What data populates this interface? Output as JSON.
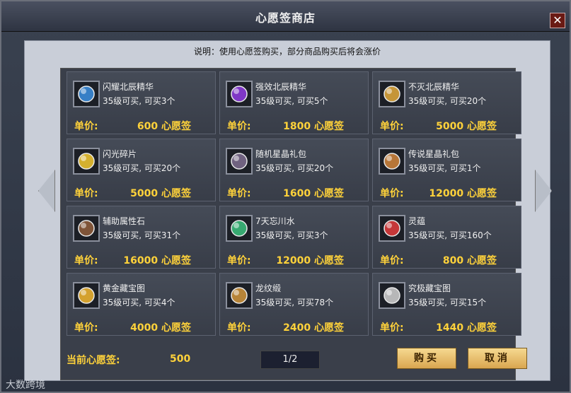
{
  "window": {
    "title": "心愿签商店",
    "close_label": "✕"
  },
  "notice": "说明：使用心愿签购买，部分商品购买后将会涨价",
  "items": [
    {
      "name": "闪耀北辰精华",
      "req": "35级可买, 可买3个",
      "price_label": "单价:",
      "price": "600 心愿签",
      "icon": "blue-orb-icon",
      "color": "#3a8ad8"
    },
    {
      "name": "强效北辰精华",
      "req": "35级可买, 可买5个",
      "price_label": "单价:",
      "price": "1800 心愿签",
      "icon": "purple-orb-icon",
      "color": "#8a3ad8"
    },
    {
      "name": "不灭北辰精华",
      "req": "35级可买, 可买20个",
      "price_label": "单价:",
      "price": "5000 心愿签",
      "icon": "gold-orb-icon",
      "color": "#d8a23a"
    },
    {
      "name": "闪光碎片",
      "req": "35级可买, 可买20个",
      "price_label": "单价:",
      "price": "5000 心愿签",
      "icon": "shard-icon",
      "color": "#e8c030"
    },
    {
      "name": "随机星晶礼包",
      "req": "35级可买, 可买20个",
      "price_label": "单价:",
      "price": "1600 心愿签",
      "icon": "gift-bag-icon",
      "color": "#7a6a8a"
    },
    {
      "name": "传说星晶礼包",
      "req": "35级可买, 可买1个",
      "price_label": "单价:",
      "price": "12000 心愿签",
      "icon": "legend-bag-icon",
      "color": "#c8803a"
    },
    {
      "name": "辅助属性石",
      "req": "35级可买, 可买31个",
      "price_label": "单价:",
      "price": "16000 心愿签",
      "icon": "stone-icon",
      "color": "#8a5a3a"
    },
    {
      "name": "7天忘川水",
      "req": "35级可买, 可买3个",
      "price_label": "单价:",
      "price": "12000 心愿签",
      "icon": "water-icon",
      "color": "#3ab87a"
    },
    {
      "name": "灵蕴",
      "req": "35级可买, 可买160个",
      "price_label": "单价:",
      "price": "800 心愿签",
      "icon": "spirit-icon",
      "color": "#d83a3a"
    },
    {
      "name": "黄金藏宝图",
      "req": "35级可买, 可买4个",
      "price_label": "单价:",
      "price": "4000 心愿签",
      "icon": "gold-map-icon",
      "color": "#e8b030"
    },
    {
      "name": "龙纹缎",
      "req": "35级可买, 可买78个",
      "price_label": "单价:",
      "price": "2400 心愿签",
      "icon": "silk-icon",
      "color": "#c8903a"
    },
    {
      "name": "究极藏宝图",
      "req": "35级可买, 可买15个",
      "price_label": "单价:",
      "price": "1440 心愿签",
      "icon": "scroll-icon",
      "color": "#c8c8c8"
    }
  ],
  "footer": {
    "wish_label": "当前心愿签:",
    "wish_value": "500",
    "page": "1/2",
    "buy_label": "购买",
    "cancel_label": "取消"
  },
  "watermark": "大数跨境"
}
